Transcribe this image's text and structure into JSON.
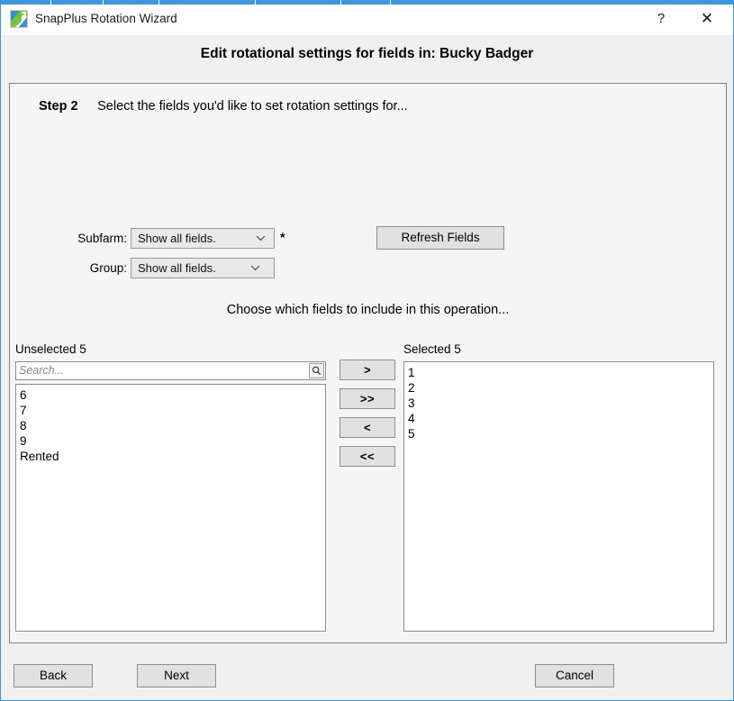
{
  "window": {
    "title": "SnapPlus Rotation Wizard",
    "help_label": "?",
    "close_label": "✕",
    "border_color": "#3e97dd"
  },
  "header": {
    "title": "Edit rotational settings for fields in: Bucky Badger"
  },
  "step": {
    "label": "Step 2",
    "description": "Select the fields you'd like to set rotation settings for..."
  },
  "filters": {
    "subfarm_label": "Subfarm:",
    "subfarm_value": "Show all fields.",
    "group_label": "Group:",
    "group_value": "Show all fields.",
    "required_marker": "*",
    "refresh_label": "Refresh Fields"
  },
  "instruction": "Choose which fields to include in this operation...",
  "unselected": {
    "label": "Unselected 5",
    "search_placeholder": "Search...",
    "search_value": "",
    "items": [
      "6",
      "7",
      "8",
      "9",
      "Rented"
    ]
  },
  "selected": {
    "label": "Selected 5",
    "items": [
      "1",
      "2",
      "3",
      "4",
      "5"
    ]
  },
  "transfer": {
    "move_right": ">",
    "move_all_right": ">>",
    "move_left": "<",
    "move_all_left": "<<"
  },
  "footer": {
    "back_label": "Back",
    "next_label": "Next",
    "cancel_label": "Cancel"
  }
}
